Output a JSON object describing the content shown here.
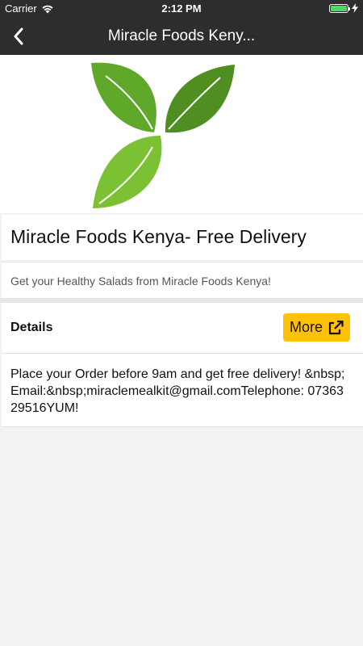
{
  "status_bar": {
    "carrier": "Carrier",
    "time": "2:12 PM",
    "battery_level": 1.0,
    "icons": [
      "wifi-icon",
      "battery-icon",
      "charging-bolt-icon"
    ]
  },
  "nav_bar": {
    "title": "Miracle Foods Keny...",
    "back_icon": "chevron-left-icon"
  },
  "hero": {
    "image": "leaf-logo",
    "leaf_colors": [
      "#5fa82a",
      "#4f8f22",
      "#7cc034"
    ]
  },
  "listing": {
    "title": "Miracle Foods Kenya- Free Delivery",
    "subtitle": "Get your Healthy Salads from Miracle Foods Kenya!"
  },
  "details": {
    "label": "Details",
    "more_label": "More",
    "more_icon": "external-link-icon",
    "description": "Place your Order before 9am and get free delivery! &nbsp;Email:&nbsp;miraclemealkit@gmail.comTelephone: 0736329516YUM!"
  },
  "colors": {
    "bar_background": "#2d2d2d",
    "accent": "#ffc107",
    "page_background": "#f2f2f2"
  }
}
